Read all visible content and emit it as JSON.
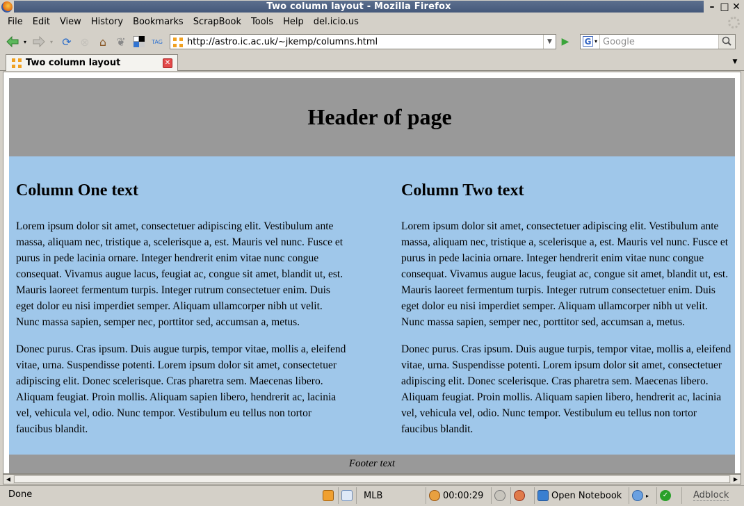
{
  "window": {
    "title": "Two column layout - Mozilla Firefox"
  },
  "menubar": {
    "items": [
      {
        "label": "File",
        "accel": "F",
        "rest": "ile"
      },
      {
        "label": "Edit",
        "accel": "E",
        "rest": "dit"
      },
      {
        "label": "View",
        "accel": "V",
        "rest": "iew"
      },
      {
        "label": "History",
        "accel": "s",
        "pre": "Hi",
        "rest": "tory"
      },
      {
        "label": "Bookmarks",
        "accel": "B",
        "rest": "ookmarks"
      },
      {
        "label": "ScrapBook",
        "accel": "S",
        "rest": "crapBook"
      },
      {
        "label": "Tools",
        "accel": "T",
        "rest": "ools"
      },
      {
        "label": "Help",
        "accel": "H",
        "rest": "elp"
      },
      {
        "label": "del.icio.us",
        "accel": "i",
        "pre": "del.",
        "rest": "cio.us"
      }
    ]
  },
  "navbar": {
    "url": "http://astro.ic.ac.uk/~jkemp/columns.html",
    "search_placeholder": "Google"
  },
  "tabs": [
    {
      "label": "Two column layout"
    }
  ],
  "page": {
    "header": "Header of page",
    "column_one": {
      "heading": "Column One text",
      "p1": "Lorem ipsum dolor sit amet, consectetuer adipiscing elit. Vestibulum ante massa, aliquam nec, tristique a, scelerisque a, est. Mauris vel nunc. Fusce et purus in pede lacinia ornare. Integer hendrerit enim vitae nunc congue consequat. Vivamus augue lacus, feugiat ac, congue sit amet, blandit ut, est. Mauris laoreet fermentum turpis. Integer rutrum consectetuer enim. Duis eget dolor eu nisi imperdiet semper. Aliquam ullamcorper nibh ut velit. Nunc massa sapien, semper nec, porttitor sed, accumsan a, metus.",
      "p2": "Donec purus. Cras ipsum. Duis augue turpis, tempor vitae, mollis a, eleifend vitae, urna. Suspendisse potenti. Lorem ipsum dolor sit amet, consectetuer adipiscing elit. Donec scelerisque. Cras pharetra sem. Maecenas libero. Aliquam feugiat. Proin mollis. Aliquam sapien libero, hendrerit ac, lacinia vel, vehicula vel, odio. Nunc tempor. Vestibulum eu tellus non tortor faucibus blandit."
    },
    "column_two": {
      "heading": "Column Two text",
      "p1": "Lorem ipsum dolor sit amet, consectetuer adipiscing elit. Vestibulum ante massa, aliquam nec, tristique a, scelerisque a, est. Mauris vel nunc. Fusce et purus in pede lacinia ornare. Integer hendrerit enim vitae nunc congue consequat. Vivamus augue lacus, feugiat ac, congue sit amet, blandit ut, est. Mauris laoreet fermentum turpis. Integer rutrum consectetuer enim. Duis eget dolor eu nisi imperdiet semper. Aliquam ullamcorper nibh ut velit. Nunc massa sapien, semper nec, porttitor sed, accumsan a, metus.",
      "p2": "Donec purus. Cras ipsum. Duis augue turpis, tempor vitae, mollis a, eleifend vitae, urna. Suspendisse potenti. Lorem ipsum dolor sit amet, consectetuer adipiscing elit. Donec scelerisque. Cras pharetra sem. Maecenas libero. Aliquam feugiat. Proin mollis. Aliquam sapien libero, hendrerit ac, lacinia vel, vehicula vel, odio. Nunc tempor. Vestibulum eu tellus non tortor faucibus blandit."
    },
    "footer": "Footer text"
  },
  "statusbar": {
    "status": "Done",
    "mlb": "MLB",
    "timer": "00:00:29",
    "notebook": "Open Notebook",
    "adblock": "Adblock"
  },
  "colors": {
    "header_bg": "#999999",
    "columns_bg": "#9fc7ea",
    "titlebar_bg": "#44587a"
  }
}
